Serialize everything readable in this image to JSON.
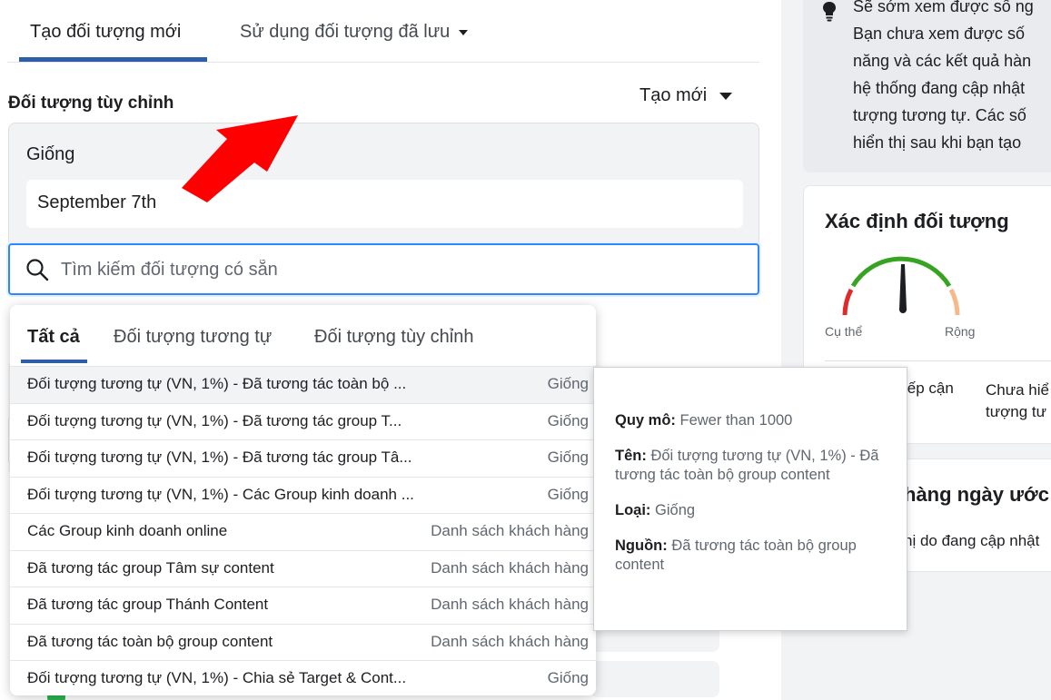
{
  "tabs": {
    "create_new": "Tạo đối tượng mới",
    "use_saved": "Sử dụng đối tượng đã lưu"
  },
  "custom_audience": {
    "title": "Đối tượng tùy chỉnh",
    "create_new_button": "Tạo mới",
    "similar_label": "Giống",
    "chip_value": "September 7th"
  },
  "search": {
    "placeholder": "Tìm kiếm đối tượng có sẵn"
  },
  "dropdown": {
    "tabs": [
      "Tất cả",
      "Đối tượng tương tự",
      "Đối tượng tùy chỉnh"
    ],
    "rows": [
      {
        "name": "Đối tượng tương tự (VN, 1%) - Đã tương tác toàn bộ ...",
        "type": "Giống"
      },
      {
        "name": "Đối tượng tương tự (VN, 1%) - Đã tương tác group T...",
        "type": "Giống"
      },
      {
        "name": "Đối tượng tương tự (VN, 1%) - Đã tương tác group Tâ...",
        "type": "Giống"
      },
      {
        "name": "Đối tượng tương tự (VN, 1%) - Các Group kinh doanh ...",
        "type": "Giống"
      },
      {
        "name": "Các Group kinh doanh online",
        "type": "Danh sách khách hàng"
      },
      {
        "name": "Đã tương tác group Tâm sự content",
        "type": "Danh sách khách hàng"
      },
      {
        "name": "Đã tương tác group Thánh Content",
        "type": "Danh sách khách hàng"
      },
      {
        "name": "Đã tương tác toàn bộ group content",
        "type": "Danh sách khách hàng"
      },
      {
        "name": "Đối tượng tương tự (VN, 1%) - Chia sẻ Target & Cont...",
        "type": "Giống"
      }
    ]
  },
  "tooltip": {
    "size_label": "Quy mô:",
    "size_value": "Fewer than 1000",
    "name_label": "Tên:",
    "name_value": "Đối tượng tương tự (VN, 1%) - Đã tương tác toàn bộ group content",
    "type_label": "Loại:",
    "type_value": "Giống",
    "source_label": "Nguồn:",
    "source_value": "Đã tương tác toàn bộ group content"
  },
  "info": {
    "title": "Sẽ sớm xem được số ng",
    "lines": [
      "Bạn chưa xem được số",
      "năng và các kết quả hàn",
      "hệ thống đang cập nhật",
      "tượng tương tự. Các số",
      "hiển thị sau khi bạn tạo"
    ]
  },
  "definition": {
    "title": "Xác định đối tượng",
    "left_label": "Cụ thể",
    "right_label": "Rộng",
    "reach_label": "iếp cận",
    "unknown_line1": "Chưa hiể",
    "unknown_line2": "tượng tư"
  },
  "daily": {
    "title": "hàng ngày ước",
    "subtitle": "hị do đang cập nhật"
  },
  "colors": {
    "accent": "#2d5fa8",
    "focus": "#2d88ff",
    "arrow": "#ff0000"
  }
}
